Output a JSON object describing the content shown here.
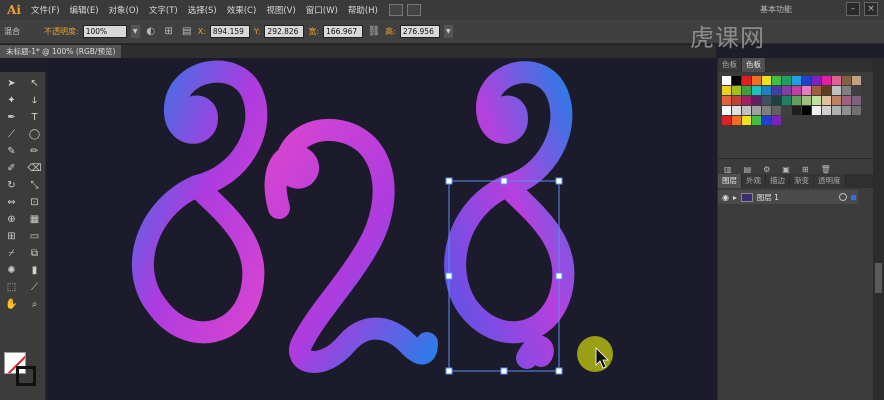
{
  "app": {
    "logo": "Ai",
    "workspace": "基本功能"
  },
  "menu": [
    "文件(F)",
    "编辑(E)",
    "对象(O)",
    "文字(T)",
    "选择(S)",
    "效果(C)",
    "视图(V)",
    "窗口(W)",
    "帮助(H)"
  ],
  "control": {
    "selection_label": "混合",
    "opacity_warn": "不透明度:",
    "opacity_value": "100%",
    "x_label": "X:",
    "x_value": "894.159",
    "y_label": "Y:",
    "y_value": "292.826",
    "w_label": "宽:",
    "w_value": "166.967",
    "h_label": "高:",
    "h_value": "276.956"
  },
  "document_tab": "未标题-1* @ 100% (RGB/预览)",
  "panel": {
    "top_tabs": [
      "色板",
      "色板"
    ],
    "layer_tabs": [
      "图层",
      "外观",
      "描边",
      "渐变",
      "透明度"
    ],
    "layer_name": "图层 1"
  },
  "watermark": "虎课网",
  "artwork": {
    "text": "828.",
    "gradient_colors": [
      "#2f7ff0",
      "#b43de8",
      "#e247d9"
    ]
  },
  "swatch_colors": [
    [
      "#ffffff",
      "#000000",
      "#e02020",
      "#f07020",
      "#f0e020",
      "#40c040",
      "#20a060",
      "#20a0e0",
      "#2040d0",
      "#8020c0",
      "#e020a0",
      "#e06090",
      "#806040",
      "#c0a080"
    ],
    [
      "#f0d020",
      "#a0c020",
      "#40a040",
      "#20c0c0",
      "#2080c0",
      "#4040a0",
      "#8040a0",
      "#c040a0",
      "#e080c0",
      "#a06040",
      "#604020",
      "#c0c0c0",
      "#808080",
      "#404040"
    ],
    [
      "#e06040",
      "#c04040",
      "#a02060",
      "#602060",
      "#405060",
      "#204040",
      "#208060",
      "#60a060",
      "#a0c080",
      "#c0e0a0",
      "#e0c0a0",
      "#c08060",
      "#a06080",
      "#806080"
    ],
    [
      "#ffffff",
      "#e0e0e0",
      "#c0c0c0",
      "#a0a0a0",
      "#808080",
      "#606060",
      "#404040",
      "#202020",
      "#000000",
      "#f0f0f0",
      "#d0d0d0",
      "#b0b0b0",
      "#909090",
      "#707070"
    ],
    [
      "#e02020",
      "#f07020",
      "#f0e020",
      "#40c040",
      "#2040d0",
      "#8020c0"
    ]
  ]
}
